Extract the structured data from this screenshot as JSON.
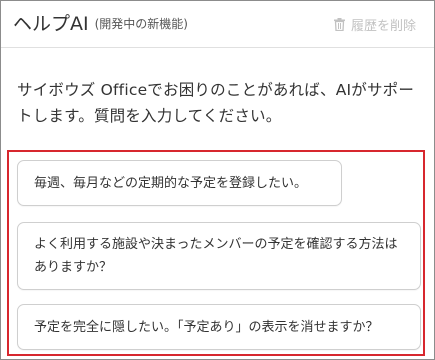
{
  "header": {
    "title": "ヘルプAI",
    "subtitle": "(開発中の新機能)",
    "clear_history_label": "履歴を削除",
    "clear_history_icon": "trash-icon"
  },
  "intro_text": "サイボウズ Officeでお困りのことがあれば、AIがサポートします。質問を入力してください。",
  "suggestions": [
    "毎週、毎月などの定期的な予定を登録したい。",
    "よく利用する施設や決まったメンバーの予定を確認する方法はありますか？",
    "予定を完全に隠したい。「予定あり」の表示を消せますか？"
  ],
  "colors": {
    "highlight_border": "#d7272e",
    "disabled_text": "#c2c2c2"
  }
}
